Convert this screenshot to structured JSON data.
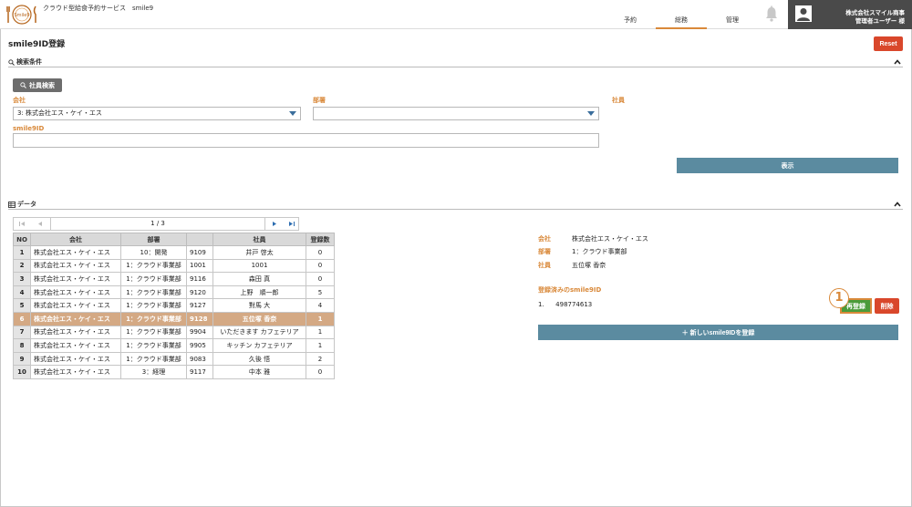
{
  "header": {
    "service_title": "クラウド型給食予約サービス　smile9",
    "tabs": [
      "予約",
      "総務",
      "管理"
    ],
    "active_tab": 1,
    "user_company": "株式会社スマイル商事",
    "user_name": "管理者ユーザー 様"
  },
  "page": {
    "title": "smile9ID登録",
    "reset_label": "Reset"
  },
  "search": {
    "section_label": "検索条件",
    "emp_search_label": "社員検索",
    "company_label": "会社",
    "company_value": "3: 株式会社エス・ケイ・エス",
    "dept_label": "部署",
    "dept_value": "",
    "employee_label": "社員",
    "smile9id_label": "smile9ID",
    "smile9id_value": "",
    "show_label": "表示"
  },
  "data_section": {
    "label": "データ",
    "pager": "1 / 3",
    "columns": [
      "NO",
      "会社",
      "部署",
      "",
      "社員",
      "登録数"
    ],
    "rows": [
      [
        "1",
        "株式会社エス・ケイ・エス",
        "10：開発",
        "9109",
        "井戸 啓太",
        "0"
      ],
      [
        "2",
        "株式会社エス・ケイ・エス",
        "1：クラウド事業部",
        "1001",
        "1001",
        "0"
      ],
      [
        "3",
        "株式会社エス・ケイ・エス",
        "1：クラウド事業部",
        "9116",
        "森田 真",
        "0"
      ],
      [
        "4",
        "株式会社エス・ケイ・エス",
        "1：クラウド事業部",
        "9120",
        "上野　順一郎",
        "5"
      ],
      [
        "5",
        "株式会社エス・ケイ・エス",
        "1：クラウド事業部",
        "9127",
        "對馬 大",
        "4"
      ],
      [
        "6",
        "株式会社エス・ケイ・エス",
        "1：クラウド事業部",
        "9128",
        "五位塚 香奈",
        "1"
      ],
      [
        "7",
        "株式会社エス・ケイ・エス",
        "1：クラウド事業部",
        "9904",
        "いただきます カフェテリア",
        "1"
      ],
      [
        "8",
        "株式会社エス・ケイ・エス",
        "1：クラウド事業部",
        "9905",
        "キッチン カフェテリア",
        "1"
      ],
      [
        "9",
        "株式会社エス・ケイ・エス",
        "1：クラウド事業部",
        "9083",
        "久後 悟",
        "2"
      ],
      [
        "10",
        "株式会社エス・ケイ・エス",
        "3：経理",
        "9117",
        "中本 雅",
        "0"
      ]
    ],
    "selected_row": 5
  },
  "detail": {
    "company_label": "会社",
    "company_value": "株式会社エス・ケイ・エス",
    "dept_label": "部署",
    "dept_value": "1：クラウド事業部",
    "employee_label": "社員",
    "employee_value": "五位塚 香奈",
    "registered_label": "登録済みのsmile9ID",
    "registered_items": [
      {
        "no": "1.",
        "id": "498774613"
      }
    ],
    "callout": "1",
    "reregister_label": "再登録",
    "delete_label": "削除",
    "new_label": "＋ 新しいsmile9IDを登録"
  },
  "colors": {
    "accent": "#d9893a",
    "danger": "#d9472b",
    "primary": "#5b8ba0",
    "success": "#4a9b3a",
    "selected_row": "#d4a984"
  }
}
